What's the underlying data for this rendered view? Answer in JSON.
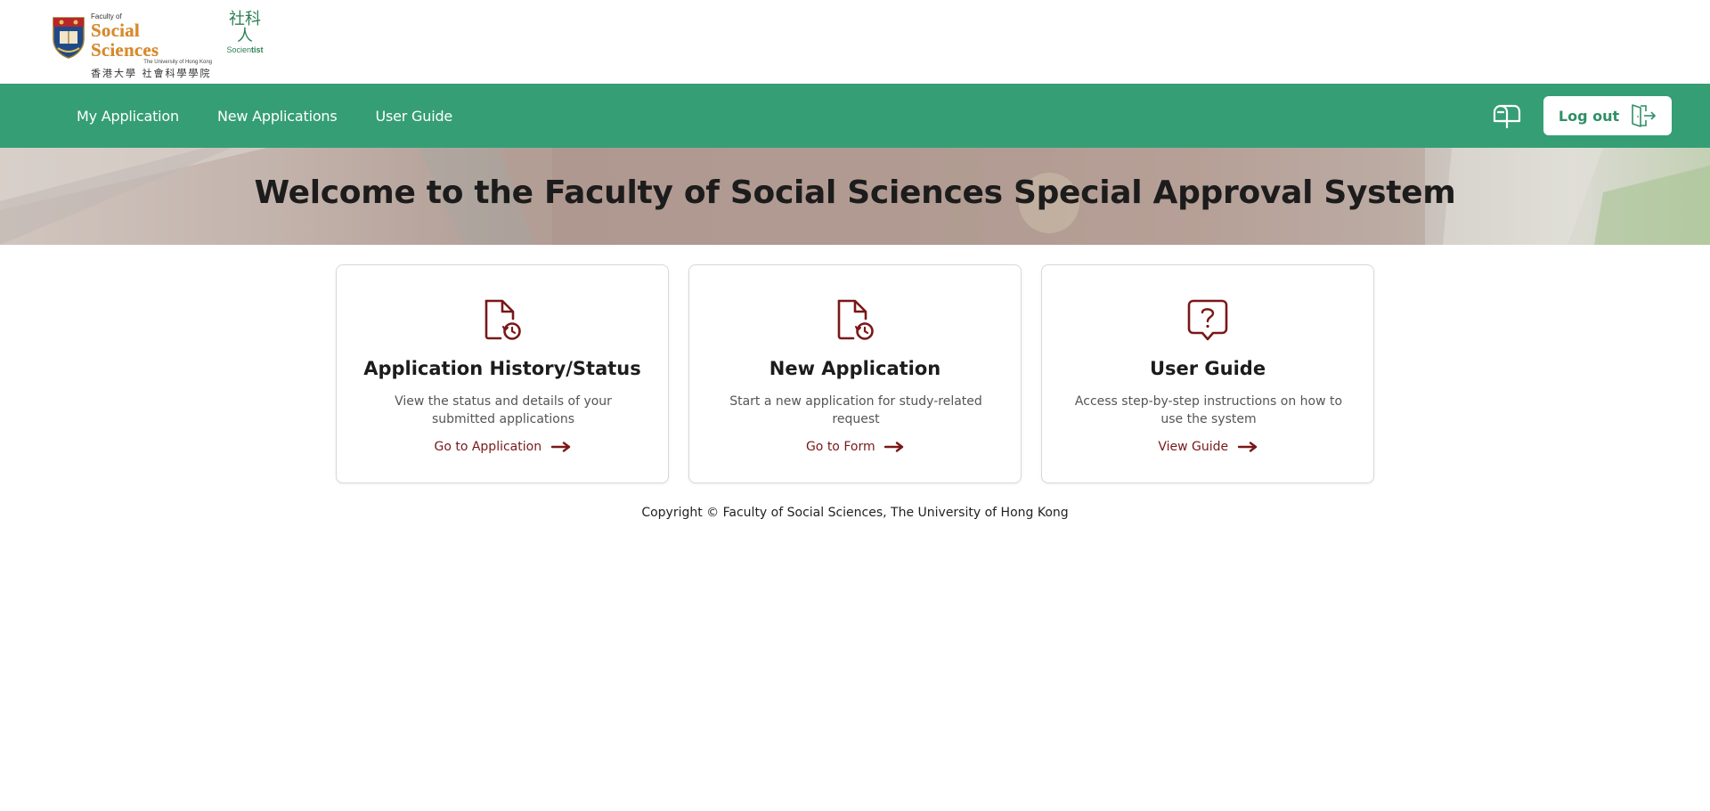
{
  "logos": {
    "fss_small": "Faculty of",
    "fss_big": "Social Sciences",
    "fss_university": "The University of Hong Kong",
    "fss_chinese": "香港大學 社會科學學院",
    "scientist_chinese": "社科人",
    "scientist_en_a": "Socien",
    "scientist_en_b": "tist"
  },
  "nav": {
    "items": [
      {
        "label": "My Application"
      },
      {
        "label": "New Applications"
      },
      {
        "label": "User Guide"
      }
    ],
    "mailbox_icon": "mailbox-icon",
    "logout_label": "Log out",
    "logout_icon": "logout-door-icon"
  },
  "hero": {
    "title": "Welcome to the Faculty of Social Sciences Special Approval System"
  },
  "cards": [
    {
      "icon": "file-history-icon",
      "title": "Application History/Status",
      "description": "View the status and details of your submitted applications",
      "link": "Go to Application"
    },
    {
      "icon": "file-history-icon",
      "title": "New Application",
      "description": "Start a new application for study-related request",
      "link": "Go to Form"
    },
    {
      "icon": "help-bubble-icon",
      "title": "User Guide",
      "description": "Access step-by-step instructions on how to use the system",
      "link": "View Guide"
    }
  ],
  "footer": {
    "copyright": "Copyright © Faculty of Social Sciences, The University of Hong Kong"
  },
  "colors": {
    "nav_green": "#359e74",
    "accent_maroon": "#7a1717",
    "logout_text": "#2f8f66"
  }
}
